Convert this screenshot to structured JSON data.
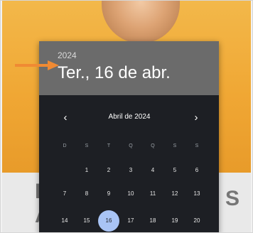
{
  "background": {
    "left_text_line1": "F",
    "left_text_line2": "A",
    "right_text": "S"
  },
  "picker": {
    "year": "2024",
    "selected_date": "Ter., 16 de abr.",
    "month_label": "Abril de 2024",
    "prev_icon": "chevron-left-icon",
    "next_icon": "chevron-right-icon",
    "weekdays": [
      "D",
      "S",
      "T",
      "Q",
      "Q",
      "S",
      "S"
    ],
    "weeks": [
      [
        "",
        "1",
        "2",
        "3",
        "4",
        "5",
        "6"
      ],
      [
        "7",
        "8",
        "9",
        "10",
        "11",
        "12",
        "13"
      ],
      [
        "14",
        "15",
        "16",
        "17",
        "18",
        "19",
        "20"
      ]
    ],
    "selected_day": "16"
  },
  "colors": {
    "arrow": "#f08a33",
    "header_bg": "#6b6b6b",
    "calendar_bg": "#1d1f24",
    "selected_day_bg": "#a9c4f5"
  }
}
